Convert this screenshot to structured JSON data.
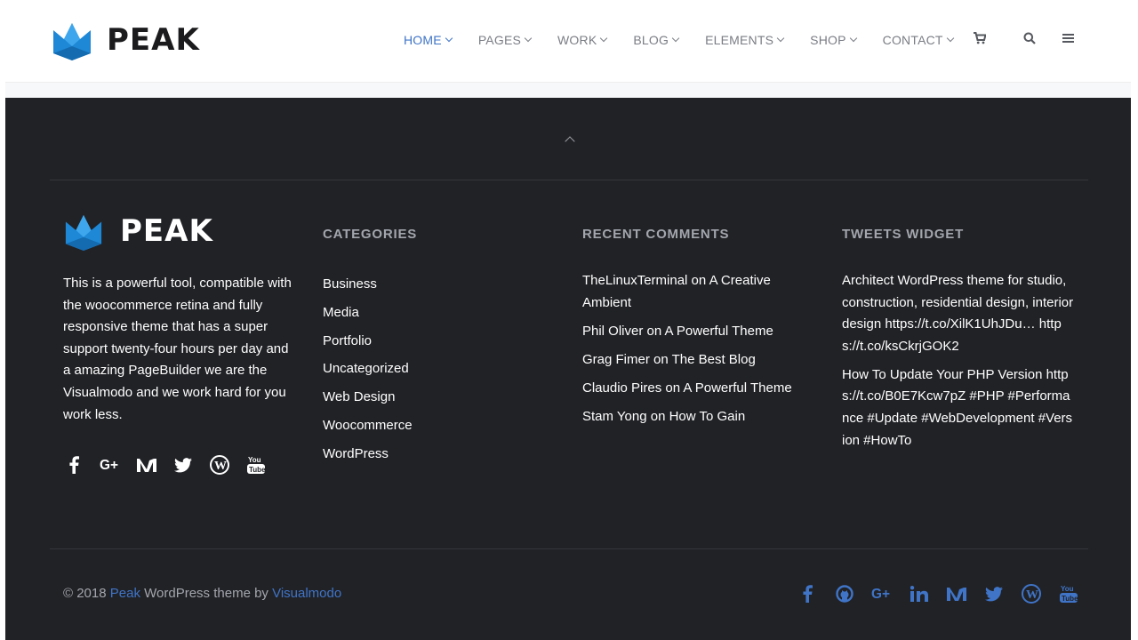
{
  "header": {
    "brand": "PEAK",
    "nav": [
      {
        "label": "HOME",
        "active": true
      },
      {
        "label": "PAGES"
      },
      {
        "label": "WORK"
      },
      {
        "label": "BLOG"
      },
      {
        "label": "ELEMENTS"
      },
      {
        "label": "SHOP"
      },
      {
        "label": "CONTACT"
      }
    ],
    "icons": [
      "cart-icon",
      "search-icon",
      "menu-icon"
    ]
  },
  "footer": {
    "brand": "PEAK",
    "about": "This is a powerful tool, compatible with the woocommerce retina and fully responsive theme that has a super support twenty-four hours per day and a amazing PageBuilder we are the Visualmodo and we work hard for you work less.",
    "social_icons": [
      "facebook-icon",
      "google-plus-icon",
      "medium-icon",
      "twitter-icon",
      "wordpress-icon",
      "youtube-icon"
    ],
    "categories": {
      "title": "CATEGORIES",
      "items": [
        "Business",
        "Media",
        "Portfolio",
        "Uncategorized",
        "Web Design",
        "Woocommerce",
        "WordPress"
      ]
    },
    "recent_comments": {
      "title": "RECENT COMMENTS",
      "items": [
        "TheLinuxTerminal on A Creative Ambient",
        "Phil Oliver on A Powerful Theme",
        "Grag Fimer on The Best Blog",
        "Claudio Pires on A Powerful Theme",
        "Stam Yong on How To Gain"
      ]
    },
    "tweets": {
      "title": "TWEETS WIDGET",
      "items": [
        "Architect WordPress theme for studio, construction, residential design, interior design https://t.co/XilK1UhJDu… https://t.co/ksCkrjGOK2",
        "How To Update Your PHP Version https://t.co/B0E7Kcw7pZ #PHP #Performance #Update #WebDevelopment #Version #HowTo"
      ]
    },
    "copyright": {
      "prefix": "© 2018",
      "brand": "Peak",
      "middle": "WordPress theme by",
      "author": "Visualmodo"
    },
    "bottom_social_icons": [
      "facebook-icon",
      "github-icon",
      "google-plus-icon",
      "linkedin-icon",
      "medium-icon",
      "twitter-icon",
      "wordpress-icon",
      "youtube-icon"
    ]
  },
  "colors": {
    "accent": "#3f74c7",
    "footer_bg": "#212226",
    "logo_blue": "#1e88d6"
  }
}
